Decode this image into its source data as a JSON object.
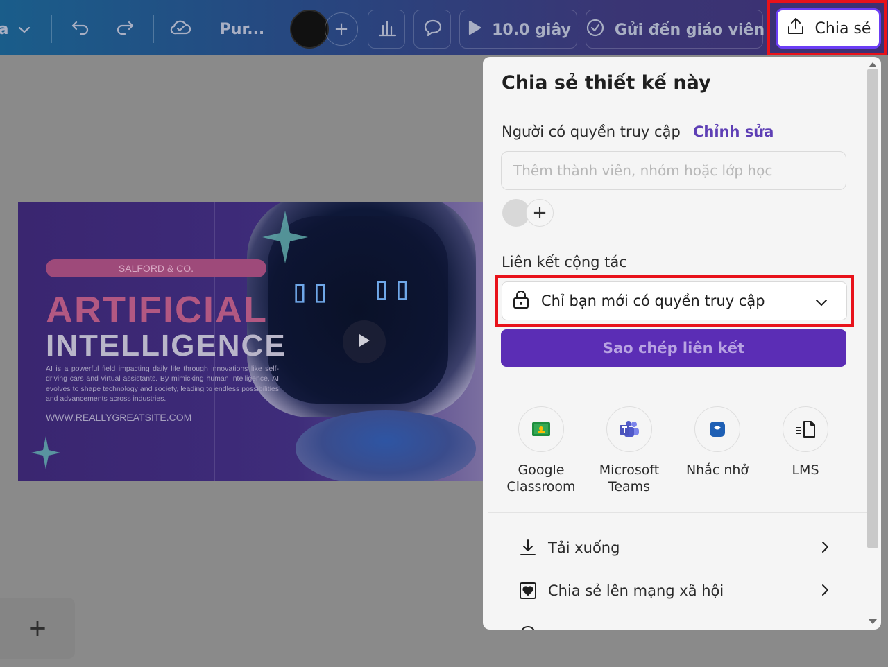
{
  "toolbar": {
    "app_partial": "a",
    "doc_name": "Pur...",
    "add_label": "+",
    "duration": "10.0 giây",
    "send_teacher": "Gửi đến giáo viên",
    "share_label": "Chia sẻ"
  },
  "design": {
    "tag": "SALFORD & CO.",
    "title_line1": "ARTIFICIAL",
    "title_line2": "INTELLIGENCE",
    "body": "AI is a powerful field impacting daily life through innovations like self-driving cars and virtual assistants. By mimicking human intelligence, AI evolves to shape technology and society, leading to endless possibilities and advancements across industries.",
    "url": "WWW.REALLYGREATSITE.COM"
  },
  "add_page_label": "+",
  "share_panel": {
    "title": "Chia sẻ thiết kế này",
    "access_label": "Người có quyền truy cập",
    "edit_link": "Chỉnh sửa",
    "member_placeholder": "Thêm thành viên, nhóm hoặc lớp học",
    "add_member_label": "+",
    "collab_label": "Liên kết cộng tác",
    "access_value": "Chỉ bạn mới có quyền truy cập",
    "copy_link": "Sao chép liên kết",
    "apps": [
      {
        "label": "Google Classroom",
        "icon": "google-classroom-icon"
      },
      {
        "label": "Microsoft Teams",
        "icon": "microsoft-teams-icon"
      },
      {
        "label": "Nhắc nhở",
        "icon": "reminder-icon"
      },
      {
        "label": "LMS",
        "icon": "lms-icon"
      }
    ],
    "rows": [
      {
        "label": "Tải xuống",
        "icon": "download-icon"
      },
      {
        "label": "Chia sẻ lên mạng xã hội",
        "icon": "social-heart-icon"
      }
    ]
  },
  "colors": {
    "accent": "#5b2db5",
    "highlight": "#e8121a",
    "link": "#5e3fb5"
  }
}
